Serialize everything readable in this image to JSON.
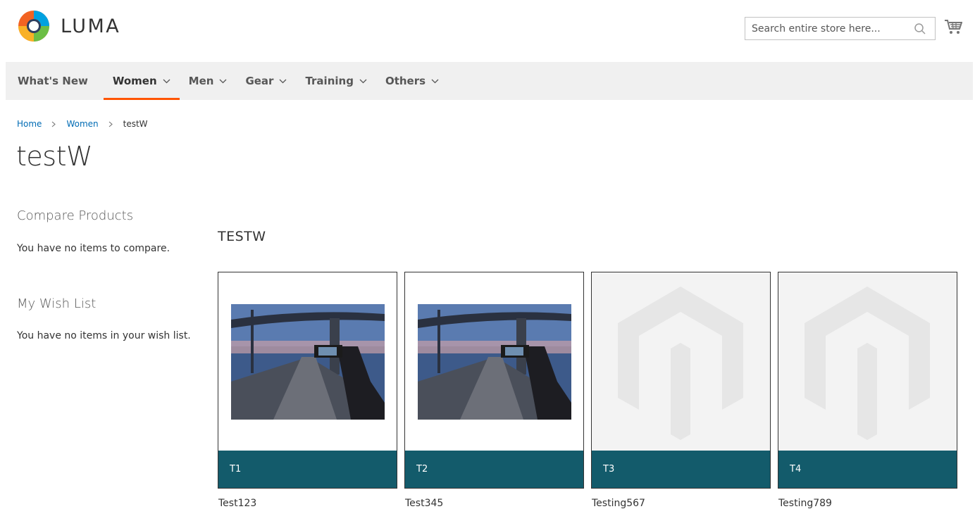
{
  "header": {
    "logo_text": "LUMA",
    "search_placeholder": "Search entire store here...",
    "brand_colors": {
      "orange": "#f26322",
      "accent": "#ff5501"
    }
  },
  "nav": {
    "items": [
      {
        "label": "What's New",
        "dropdown": false
      },
      {
        "label": "Women",
        "dropdown": true,
        "active": true
      },
      {
        "label": "Men",
        "dropdown": true
      },
      {
        "label": "Gear",
        "dropdown": true
      },
      {
        "label": "Training",
        "dropdown": true
      },
      {
        "label": "Others",
        "dropdown": true
      }
    ]
  },
  "breadcrumb": {
    "items": [
      "Home",
      "Women"
    ],
    "current": "testW"
  },
  "page": {
    "title": "testW"
  },
  "sidebar": {
    "compare_title": "Compare Products",
    "compare_text": "You have no items to compare.",
    "wishlist_title": "My Wish List",
    "wishlist_text": "You have no items in your wish list."
  },
  "main": {
    "section_title": "TESTW",
    "products": [
      {
        "label": "T1",
        "name": "Test123",
        "image": "photo"
      },
      {
        "label": "T2",
        "name": "Test345",
        "image": "photo"
      },
      {
        "label": "T3",
        "name": "Testing567",
        "image": "placeholder"
      },
      {
        "label": "T4",
        "name": "Testing789",
        "image": "placeholder"
      }
    ],
    "label_bar_color": "#135b6b"
  }
}
